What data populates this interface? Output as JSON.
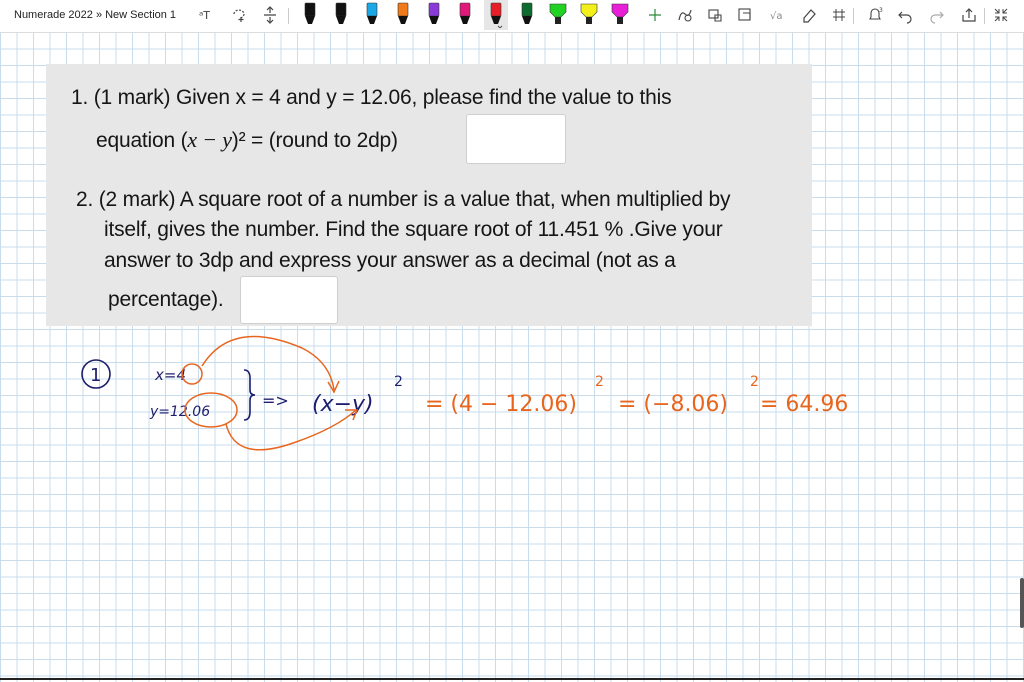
{
  "toolbar": {
    "breadcrumb": "Numerade 2022 » New Section 1",
    "pens": [
      {
        "icon": "pen-black-icon",
        "color": "#111111"
      },
      {
        "icon": "pen-black-icon",
        "color": "#111111"
      },
      {
        "icon": "pen-blue-icon",
        "color": "#1aa8e6"
      },
      {
        "icon": "pen-orange-icon",
        "color": "#f07a1a"
      },
      {
        "icon": "pen-purple-icon",
        "color": "#8a3ad8"
      },
      {
        "icon": "pen-pink-icon",
        "color": "#e0197a"
      },
      {
        "icon": "pen-red-icon",
        "color": "#e61e28"
      },
      {
        "icon": "pen-darkgreen-icon",
        "color": "#0d6b2e"
      },
      {
        "icon": "highlighter-green-icon",
        "color": "#22d222"
      },
      {
        "icon": "highlighter-yellow-icon",
        "color": "#f2ef1a"
      },
      {
        "icon": "highlighter-magenta-icon",
        "color": "#e81fd6"
      }
    ]
  },
  "question": {
    "q1_line1": "1. (1 mark) Given x = 4 and y = 12.06, please find the value to this",
    "q1_line2_a": "equation (",
    "q1_line2_math": "x − y",
    "q1_line2_b": ")² = (round to 2dp)",
    "q2_line1": "2. (2 mark) A square root of a number is a value that, when multiplied by",
    "q2_line2": "itself, gives the number. Find the square root of 11.451 % .Give your",
    "q2_line3": "answer to 3dp and express your answer as a decimal (not as a",
    "q2_line4": "percentage)."
  },
  "handwriting": {
    "number": "1",
    "x_def": "x=4",
    "y_def": "y=12.06",
    "implies": "=>",
    "expr": "(x−y)",
    "exp": "2",
    "step1": "= (4 − 12.06)",
    "step2": "= (−8.06)",
    "result": "= 64.96",
    "ink_black": "#1e1e6e",
    "ink_orange": "#e8651e"
  }
}
